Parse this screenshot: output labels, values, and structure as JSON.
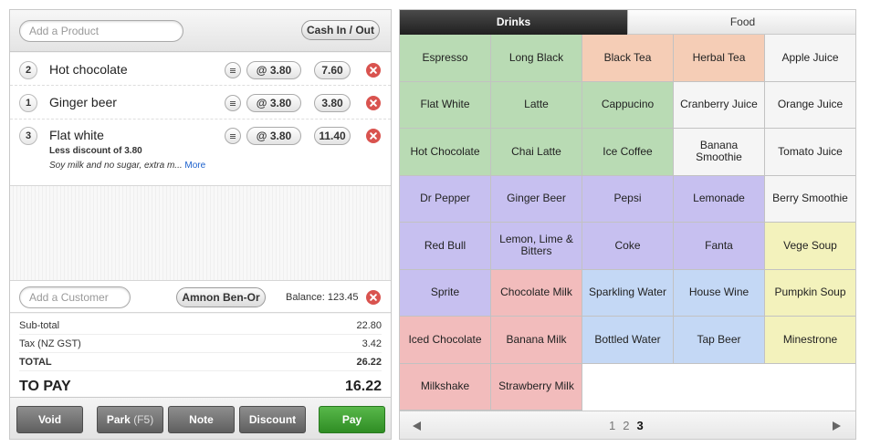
{
  "order_panel": {
    "product_search_placeholder": "Add a Product",
    "cash_button": "Cash In / Out",
    "items": [
      {
        "qty": "2",
        "name": "Hot chocolate",
        "unit_price": "@ 3.80",
        "total": "7.60"
      },
      {
        "qty": "1",
        "name": "Ginger beer",
        "unit_price": "@ 3.80",
        "total": "3.80"
      },
      {
        "qty": "3",
        "name": "Flat white",
        "unit_price": "@ 3.80",
        "total": "11.40",
        "discount": "Less discount of 3.80",
        "modifier": "Soy milk and no sugar, extra m...",
        "more_link": "More"
      }
    ],
    "customer_placeholder": "Add a Customer",
    "customer_name": "Amnon Ben-Or",
    "balance": "Balance: 123.45",
    "totals": {
      "subtotal_label": "Sub-total",
      "subtotal": "22.80",
      "tax_label": "Tax (NZ GST)",
      "tax": "3.42",
      "total_label": "TOTAL",
      "total": "26.22",
      "topay_label": "TO PAY",
      "topay": "16.22"
    },
    "actions": {
      "void": "Void",
      "park": "Park",
      "park_shortcut": "(F5)",
      "note": "Note",
      "discount": "Discount",
      "pay": "Pay"
    }
  },
  "product_panel": {
    "tabs": [
      {
        "label": "Drinks",
        "active": true
      },
      {
        "label": "Food",
        "active": false
      }
    ],
    "colors": {
      "green": "#b9dbb4",
      "peach": "#f5cdb6",
      "white": "#f5f5f5",
      "purple": "#c7c0f0",
      "yellow": "#f3f2bc",
      "red": "#f2bcbc",
      "blue": "#c4d8f5"
    },
    "products": [
      {
        "label": "Espresso",
        "color": "green"
      },
      {
        "label": "Long Black",
        "color": "green"
      },
      {
        "label": "Black Tea",
        "color": "peach"
      },
      {
        "label": "Herbal Tea",
        "color": "peach"
      },
      {
        "label": "Apple Juice",
        "color": "white"
      },
      {
        "label": "Flat White",
        "color": "green"
      },
      {
        "label": "Latte",
        "color": "green"
      },
      {
        "label": "Cappucino",
        "color": "green"
      },
      {
        "label": "Cranberry Juice",
        "color": "white"
      },
      {
        "label": "Orange Juice",
        "color": "white"
      },
      {
        "label": "Hot Chocolate",
        "color": "green"
      },
      {
        "label": "Chai Latte",
        "color": "green"
      },
      {
        "label": "Ice Coffee",
        "color": "green"
      },
      {
        "label": "Banana Smoothie",
        "color": "white"
      },
      {
        "label": "Tomato Juice",
        "color": "white"
      },
      {
        "label": "Dr Pepper",
        "color": "purple"
      },
      {
        "label": "Ginger Beer",
        "color": "purple"
      },
      {
        "label": "Pepsi",
        "color": "purple"
      },
      {
        "label": "Lemonade",
        "color": "purple"
      },
      {
        "label": "Berry Smoothie",
        "color": "white"
      },
      {
        "label": "Red Bull",
        "color": "purple"
      },
      {
        "label": "Lemon, Lime & Bitters",
        "color": "purple"
      },
      {
        "label": "Coke",
        "color": "purple"
      },
      {
        "label": "Fanta",
        "color": "purple"
      },
      {
        "label": "Vege Soup",
        "color": "yellow"
      },
      {
        "label": "Sprite",
        "color": "purple"
      },
      {
        "label": "Chocolate Milk",
        "color": "red"
      },
      {
        "label": "Sparkling Water",
        "color": "blue"
      },
      {
        "label": "House Wine",
        "color": "blue"
      },
      {
        "label": "Pumpkin Soup",
        "color": "yellow"
      },
      {
        "label": "Iced Chocolate",
        "color": "red"
      },
      {
        "label": "Banana Milk",
        "color": "red"
      },
      {
        "label": "Bottled Water",
        "color": "blue"
      },
      {
        "label": "Tap Beer",
        "color": "blue"
      },
      {
        "label": "Minestrone",
        "color": "yellow"
      },
      {
        "label": "Milkshake",
        "color": "red"
      },
      {
        "label": "Strawberry Milk",
        "color": "red"
      }
    ],
    "pager": {
      "pages": [
        "1",
        "2",
        "3"
      ],
      "current": "3"
    }
  }
}
